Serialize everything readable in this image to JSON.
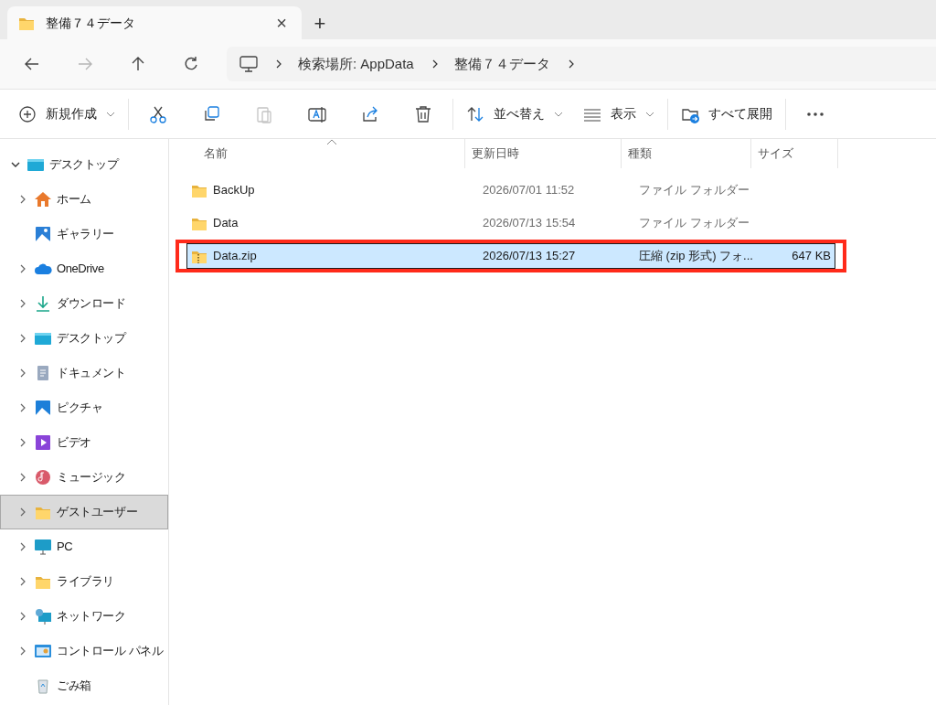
{
  "tab": {
    "title": "整備７４データ",
    "close": "×",
    "new_tab": "+"
  },
  "nav": {
    "buttons": [
      {
        "kind": "back",
        "disabled": false
      },
      {
        "kind": "forward",
        "disabled": true
      },
      {
        "kind": "up",
        "disabled": false
      },
      {
        "kind": "refresh",
        "disabled": false
      }
    ],
    "breadcrumb": [
      "検索場所: AppData",
      "整備７４データ"
    ]
  },
  "toolbar": [
    [
      {
        "kind": "new",
        "label": "新規作成",
        "dropdown": true,
        "disabled": false
      }
    ],
    [
      {
        "kind": "cut",
        "disabled": false
      },
      {
        "kind": "copy",
        "disabled": false
      },
      {
        "kind": "paste",
        "disabled": true
      },
      {
        "kind": "rename",
        "disabled": false
      },
      {
        "kind": "share",
        "disabled": false
      },
      {
        "kind": "delete",
        "disabled": false
      }
    ],
    [
      {
        "kind": "sort",
        "label": "並べ替え",
        "dropdown": true,
        "disabled": false
      },
      {
        "kind": "view",
        "label": "表示",
        "dropdown": true,
        "disabled": false
      }
    ],
    [
      {
        "kind": "extract",
        "label": "すべて展開",
        "dropdown": false,
        "disabled": false
      }
    ],
    [
      {
        "kind": "more",
        "disabled": false
      }
    ]
  ],
  "sidebar": {
    "items": [
      {
        "label": "デスクトップ",
        "kind": "desktop",
        "expandable": true,
        "expanded": true,
        "selected": false,
        "children": [
          {
            "label": "ホーム",
            "kind": "home",
            "expandable": true,
            "expanded": false,
            "selected": false
          },
          {
            "label": "ギャラリー",
            "kind": "gallery",
            "expandable": false,
            "selected": false
          },
          {
            "label": "OneDrive",
            "kind": "cloud",
            "expandable": true,
            "expanded": false,
            "selected": false
          },
          {
            "label": "ダウンロード",
            "kind": "download",
            "expandable": true,
            "expanded": false,
            "selected": false
          },
          {
            "label": "デスクトップ",
            "kind": "desktop",
            "expandable": true,
            "expanded": false,
            "selected": false
          },
          {
            "label": "ドキュメント",
            "kind": "document",
            "expandable": true,
            "expanded": false,
            "selected": false
          },
          {
            "label": "ピクチャ",
            "kind": "pictures",
            "expandable": true,
            "expanded": false,
            "selected": false
          },
          {
            "label": "ビデオ",
            "kind": "video",
            "expandable": true,
            "expanded": false,
            "selected": false
          },
          {
            "label": "ミュージック",
            "kind": "music",
            "expandable": true,
            "expanded": false,
            "selected": false
          },
          {
            "label": "ゲストユーザー",
            "kind": "folder",
            "expandable": true,
            "expanded": false,
            "selected": true
          },
          {
            "label": "PC",
            "kind": "pc",
            "expandable": true,
            "expanded": false,
            "selected": false
          },
          {
            "label": "ライブラリ",
            "kind": "folder",
            "expandable": true,
            "expanded": false,
            "selected": false
          },
          {
            "label": "ネットワーク",
            "kind": "network",
            "expandable": true,
            "expanded": false,
            "selected": false
          },
          {
            "label": "コントロール パネル",
            "kind": "control",
            "expandable": true,
            "expanded": false,
            "selected": false
          },
          {
            "label": "ごみ箱",
            "kind": "trash",
            "expandable": false,
            "selected": false
          }
        ]
      }
    ]
  },
  "table": {
    "columns": [
      "名前",
      "更新日時",
      "種類",
      "サイズ"
    ],
    "rows": [
      {
        "kind": "folder",
        "name": "BackUp",
        "modified": "2026/07/01 11:52",
        "type": "ファイル フォルダー",
        "selected": false,
        "annotated": false
      },
      {
        "kind": "folder",
        "name": "Data",
        "modified": "2026/07/13 15:54",
        "type": "ファイル フォルダー",
        "selected": false,
        "annotated": false
      },
      {
        "kind": "zip",
        "name": "Data.zip",
        "modified": "2026/07/13 15:27",
        "type": "圧縮 (zip 形式) フォ...",
        "size": "647 KB",
        "selected": true,
        "annotated": true
      }
    ]
  }
}
